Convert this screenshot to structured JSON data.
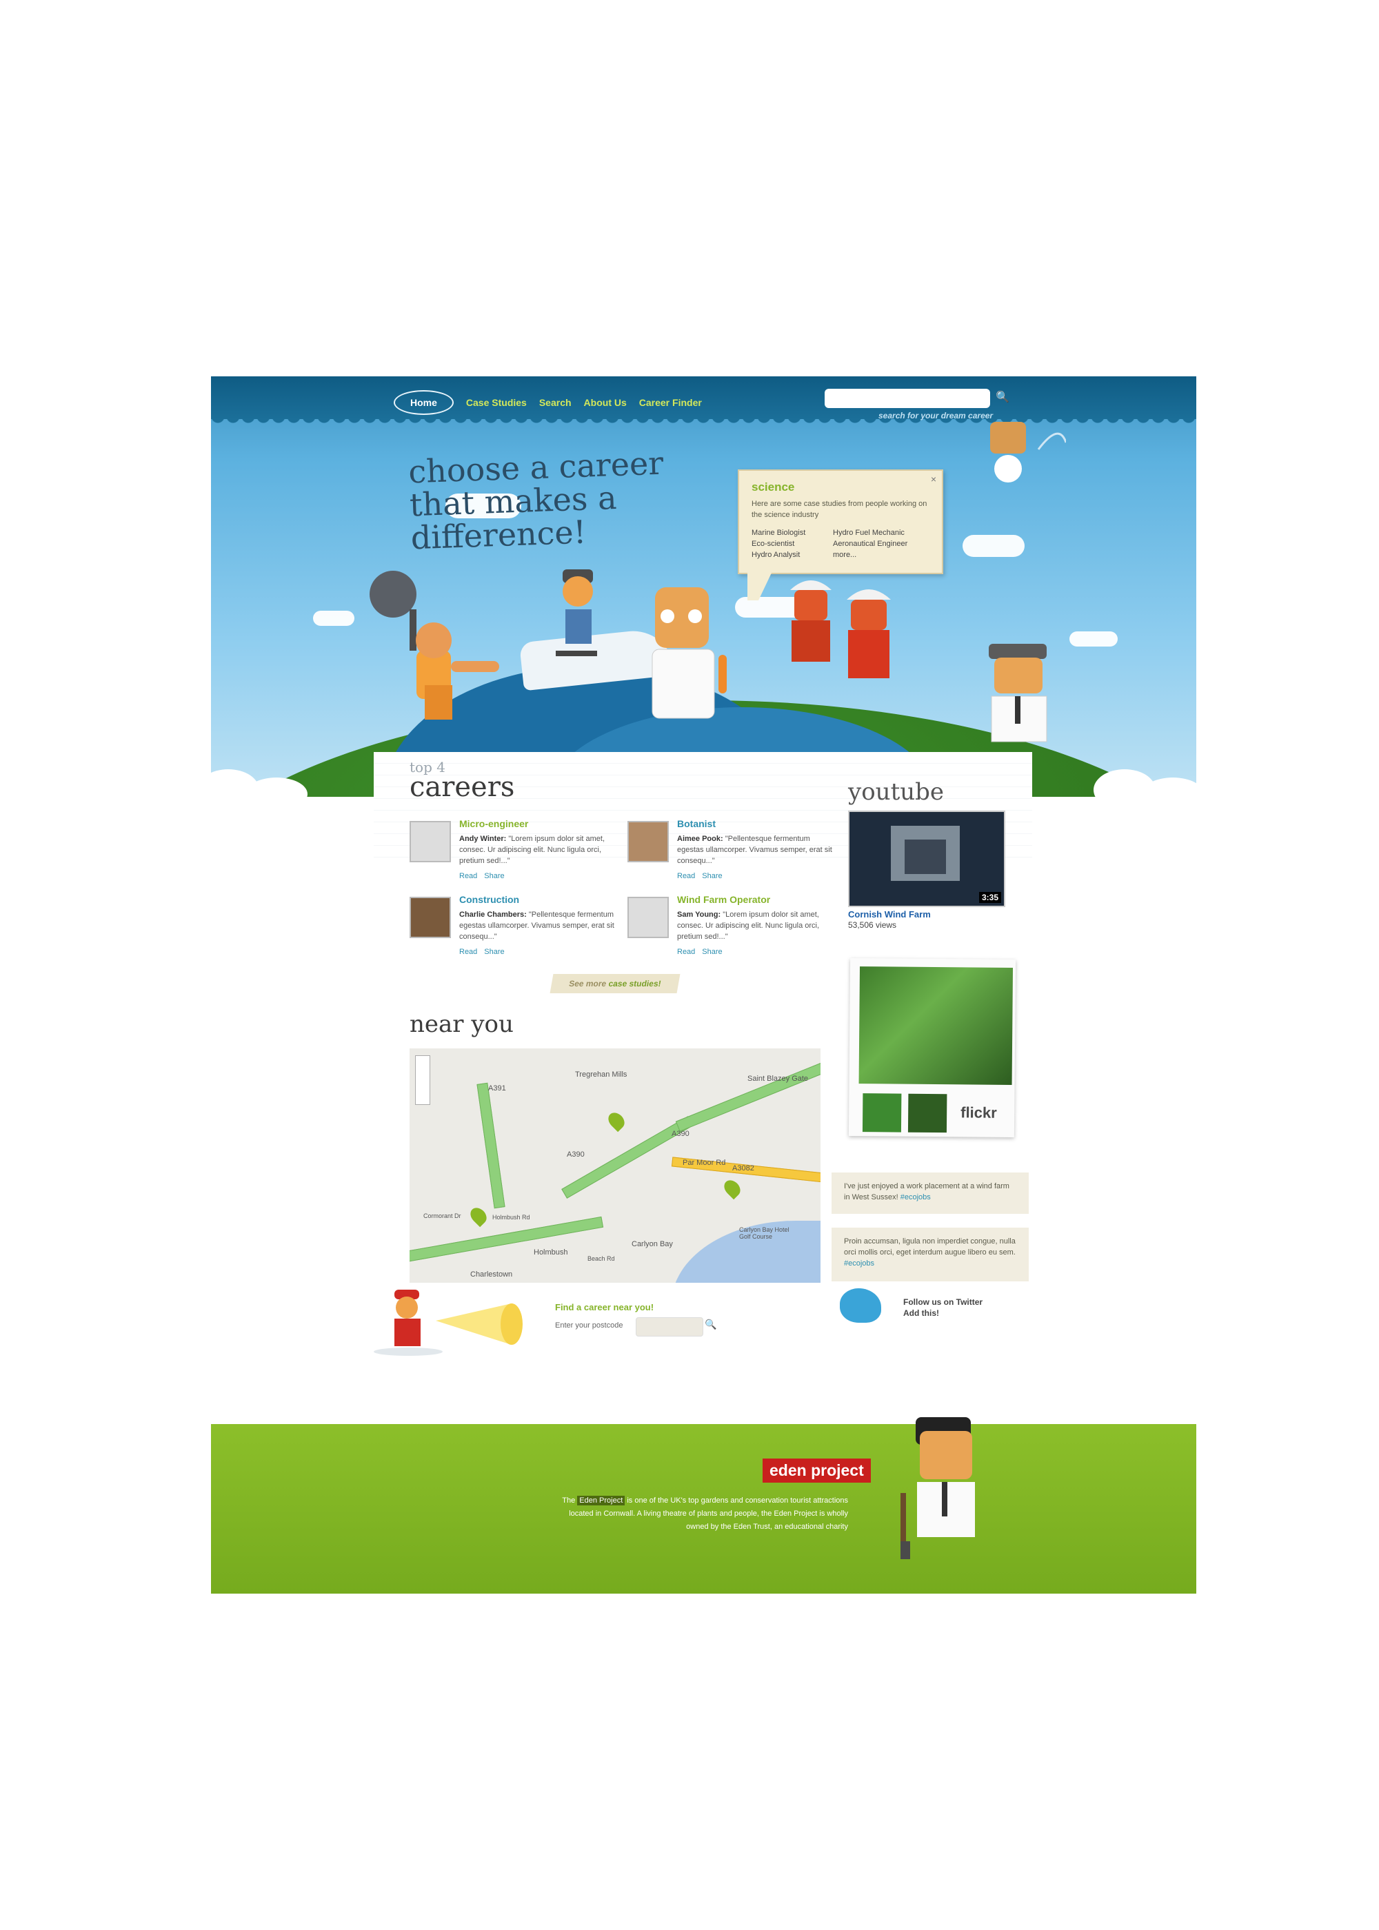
{
  "nav": {
    "items": [
      "Home",
      "Case Studies",
      "Search",
      "About Us",
      "Career Finder"
    ],
    "search_placeholder": "",
    "search_hint": "search for your dream career"
  },
  "hero": {
    "headline": [
      "choose a career",
      "that makes a",
      "difference!"
    ],
    "bubble": {
      "title": "science",
      "text": "Here are some case studies from people working on the science industry",
      "col1": [
        "Marine Biologist",
        "Eco-scientist",
        "Hydro Analysit"
      ],
      "col2": [
        "Hydro Fuel Mechanic",
        "Aeronautical Engineer",
        "more..."
      ],
      "close": "×"
    }
  },
  "top_careers": {
    "label_small": "top 4",
    "label_large": "careers",
    "items": [
      {
        "title": "Micro-engineer",
        "author": "Andy Winter:",
        "quote": "\"Lorem ipsum dolor sit amet, consec. Ur adipiscing elit. Nunc ligula orci, pretium sed!...\"",
        "read": "Read",
        "share": "Share",
        "color": "#86b42b"
      },
      {
        "title": "Botanist",
        "author": "Aimee Pook:",
        "quote": "\"Pellentesque fermentum egestas ullamcorper. Vivamus semper, erat sit consequ...\"",
        "read": "Read",
        "share": "Share",
        "color": "#2d8fb0"
      },
      {
        "title": "Construction",
        "author": "Charlie Chambers:",
        "quote": "\"Pellentesque fermentum egestas ullamcorper. Vivamus semper, erat sit consequ...\"",
        "read": "Read",
        "share": "Share",
        "color": "#2d8fb0"
      },
      {
        "title": "Wind Farm Operator",
        "author": "Sam Young:",
        "quote": "\"Lorem ipsum dolor sit amet, consec. Ur adipiscing elit. Nunc ligula orci, pretium sed!...\"",
        "read": "Read",
        "share": "Share",
        "color": "#86b42b"
      }
    ],
    "see_more_a": "See more",
    "see_more_b": "case studies!"
  },
  "near_you": {
    "label": "near you",
    "map_labels": [
      "Tregrehan Mills",
      "Saint Blazey Gate",
      "Par Moor Rd",
      "A3082",
      "A391",
      "A390",
      "A390",
      "Holmbush",
      "Carlyon Bay",
      "Carlyon Bay Hotel Golf Course",
      "Charlestown",
      "Beach Rd",
      "Holmbush Rd",
      "Cormorant Dr"
    ],
    "find_title": "Find a career near you!",
    "postcode_label": "Enter your postcode",
    "postcode_value": ""
  },
  "youtube": {
    "label": "youtube",
    "duration": "3:35",
    "title": "Cornish Wind Farm",
    "views": "53,506 views"
  },
  "flickr": {
    "label": "flickr"
  },
  "twitter": {
    "tweets": [
      {
        "text": "I've just enjoyed a work placement at a wind farm in West Sussex!",
        "tag": "#ecojobs"
      },
      {
        "text": "Proin accumsan, ligula non imperdiet congue, nulla orci mollis orci, eget interdum augue libero eu sem.",
        "tag": "#ecojobs"
      }
    ],
    "follow": "Follow us on Twitter",
    "add": "Add this!"
  },
  "footer": {
    "brand": "eden project",
    "text_before": "The",
    "link": "Eden Project",
    "text_after": "is one of the UK's top gardens and conservation tourist attractions located in Cornwall. A living theatre of plants and people, the Eden Project is wholly owned by the Eden Trust, an educational charity"
  },
  "colors": {
    "accent_green": "#86b42b",
    "link_blue": "#2d8fb0",
    "brand_red": "#c9201d",
    "nav_blue": "#0f5c84"
  }
}
